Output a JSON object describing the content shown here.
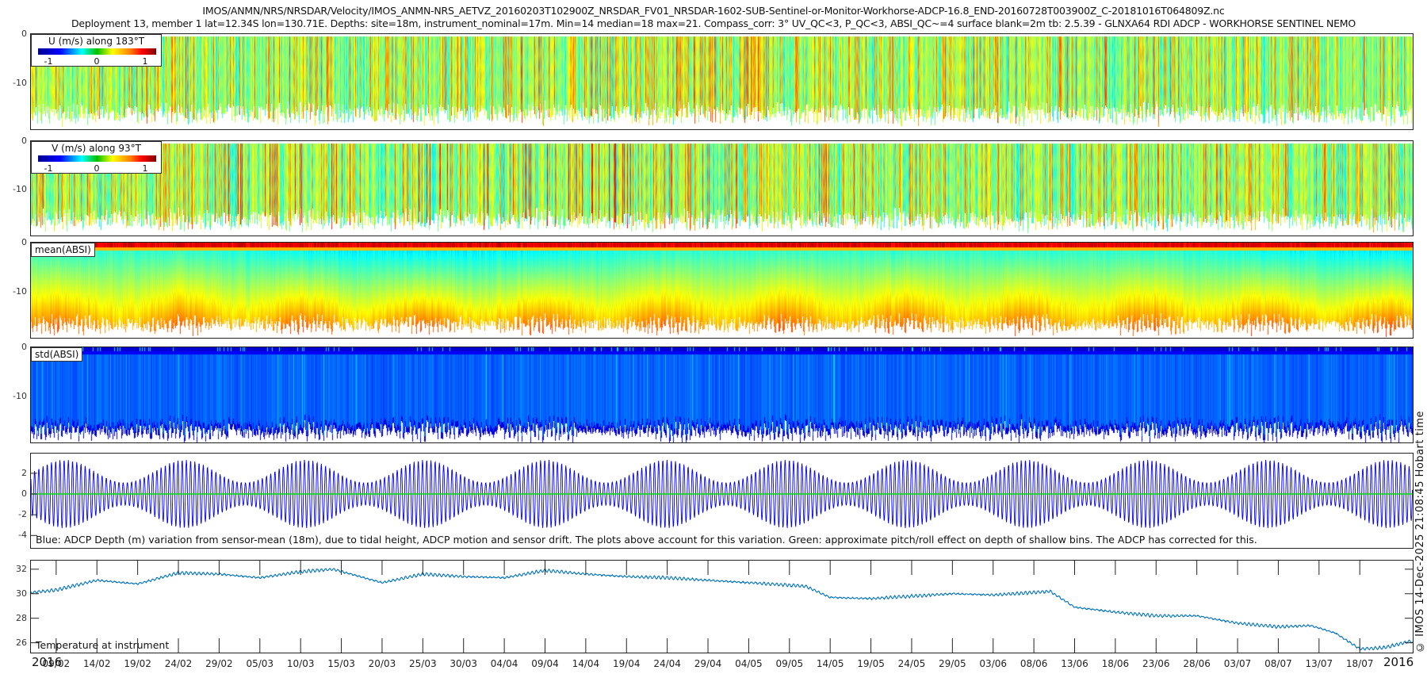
{
  "header": {
    "title_line1": "IMOS/ANMN/NRS/NRSDAR/Velocity/IMOS_ANMN-NRS_AETVZ_20160203T102900Z_NRSDAR_FV01_NRSDAR-1602-SUB-Sentinel-or-Monitor-Workhorse-ADCP-16.8_END-20160728T003900Z_C-20181016T064809Z.nc",
    "title_line2": "Deployment 13, member 1 lat=12.34S lon=130.71E. Depths: site=18m, instrument_nominal=17m. Min=14 median=18 max=21. Compass_corr: 3° UV_QC<3, P_QC<3, ABSI_QC~=4 surface blank=2m tb: 2.5.39 - GLNXA64 RDI ADCP - WORKHORSE SENTINEL NEMO"
  },
  "credit": "© IMOS 14-Dec-2025 21:08:45 Hobart time",
  "x_axis": {
    "year_left": "2016",
    "year_right": "2016",
    "xlim_days_since_2016_01_01": [
      35.9,
      205.5
    ],
    "ticks": [
      {
        "label": "09/02",
        "day": 39
      },
      {
        "label": "14/02",
        "day": 44
      },
      {
        "label": "19/02",
        "day": 49
      },
      {
        "label": "24/02",
        "day": 54
      },
      {
        "label": "29/02",
        "day": 59
      },
      {
        "label": "05/03",
        "day": 64
      },
      {
        "label": "10/03",
        "day": 69
      },
      {
        "label": "15/03",
        "day": 74
      },
      {
        "label": "20/03",
        "day": 79
      },
      {
        "label": "25/03",
        "day": 84
      },
      {
        "label": "30/03",
        "day": 89
      },
      {
        "label": "04/04",
        "day": 94
      },
      {
        "label": "09/04",
        "day": 99
      },
      {
        "label": "14/04",
        "day": 104
      },
      {
        "label": "19/04",
        "day": 109
      },
      {
        "label": "24/04",
        "day": 114
      },
      {
        "label": "29/04",
        "day": 119
      },
      {
        "label": "04/05",
        "day": 124
      },
      {
        "label": "09/05",
        "day": 129
      },
      {
        "label": "14/05",
        "day": 134
      },
      {
        "label": "19/05",
        "day": 139
      },
      {
        "label": "24/05",
        "day": 144
      },
      {
        "label": "29/05",
        "day": 149
      },
      {
        "label": "03/06",
        "day": 154
      },
      {
        "label": "08/06",
        "day": 159
      },
      {
        "label": "13/06",
        "day": 164
      },
      {
        "label": "18/06",
        "day": 169
      },
      {
        "label": "23/06",
        "day": 174
      },
      {
        "label": "28/06",
        "day": 179
      },
      {
        "label": "03/07",
        "day": 184
      },
      {
        "label": "08/07",
        "day": 189
      },
      {
        "label": "13/07",
        "day": 194
      },
      {
        "label": "18/07",
        "day": 199
      }
    ]
  },
  "chart_data": [
    {
      "type": "heatmap",
      "name": "u_velocity",
      "legend_label": "U (m/s) along 183°T",
      "colorbar_ticks": [
        "-1",
        "0",
        "1"
      ],
      "clim": [
        -1.2,
        1.2
      ],
      "colormap": "jet",
      "ylabel": "",
      "yticks": [
        "0",
        "-10"
      ],
      "ytick_values": [
        0,
        -10
      ],
      "ylim": [
        -19.5,
        0
      ],
      "typical_value": 0.05,
      "depth_bottom_range_m": [
        -18,
        -14
      ]
    },
    {
      "type": "heatmap",
      "name": "v_velocity",
      "legend_label": "V (m/s) along 93°T",
      "colorbar_ticks": [
        "-1",
        "0",
        "1"
      ],
      "clim": [
        -1.2,
        1.2
      ],
      "colormap": "jet",
      "yticks": [
        "0",
        "-10"
      ],
      "ytick_values": [
        0,
        -10
      ],
      "ylim": [
        -19.5,
        0
      ],
      "typical_value": 0.1,
      "depth_bottom_range_m": [
        -18,
        -14
      ]
    },
    {
      "type": "heatmap",
      "name": "mean_absi",
      "label": "mean(ABSI)",
      "colormap": "jet",
      "yticks": [
        "0",
        "-10"
      ],
      "ytick_values": [
        0,
        -10
      ],
      "ylim": [
        -19.5,
        0
      ]
    },
    {
      "type": "heatmap",
      "name": "std_absi",
      "label": "std(ABSI)",
      "colormap": "jet",
      "yticks": [
        "0",
        "-10"
      ],
      "ytick_values": [
        0,
        -10
      ],
      "ylim": [
        -19.5,
        0
      ]
    },
    {
      "type": "line",
      "name": "adcp_depth_variation",
      "caption": "Blue: ADCP Depth (m) variation from sensor-mean (18m), due to tidal height, ADCP motion and sensor drift. The plots above account for this variation. Green: approximate pitch/roll effect on depth of shallow bins. The ADCP has corrected for this.",
      "yticks": [
        "2",
        "0",
        "-2",
        "-4"
      ],
      "ytick_values": [
        2,
        0,
        -2,
        -4
      ],
      "ylim": [
        -5.2,
        3.9
      ],
      "series": [
        {
          "name": "depth variation",
          "color": "#0000ff",
          "tidal_period_hours": 12.42,
          "spring_neap_period_days": 14.77,
          "first_spring_day": 40,
          "spring_amplitude_m": 3.3,
          "neap_amplitude_m": 1.1
        },
        {
          "name": "pitch/roll effect",
          "color": "#00dd00",
          "value_m": 0
        }
      ]
    },
    {
      "type": "line",
      "name": "temperature",
      "label": "Temperature at instrument",
      "yticks": [
        "32",
        "30",
        "28",
        "26"
      ],
      "ytick_values": [
        32,
        30,
        28,
        26
      ],
      "ylim": [
        25.2,
        32.7
      ],
      "color": "#0072bd",
      "x_days": [
        36,
        39,
        44,
        49,
        54,
        59,
        64,
        69,
        73,
        79,
        84,
        89,
        94,
        99,
        104,
        109,
        114,
        119,
        124,
        129,
        131,
        134,
        139,
        144,
        149,
        154,
        159,
        161,
        164,
        169,
        174,
        179,
        184,
        189,
        193,
        196,
        199,
        202,
        205
      ],
      "y": [
        30.1,
        30.3,
        31.1,
        30.8,
        31.7,
        31.6,
        31.3,
        31.8,
        32.0,
        30.9,
        31.6,
        31.4,
        31.3,
        31.9,
        31.6,
        31.4,
        31.3,
        31.1,
        30.9,
        30.7,
        30.6,
        29.7,
        29.6,
        29.8,
        30.0,
        29.9,
        30.1,
        30.2,
        28.9,
        28.5,
        28.2,
        28.2,
        27.6,
        27.3,
        27.4,
        26.8,
        25.5,
        25.6,
        26.1
      ]
    }
  ]
}
